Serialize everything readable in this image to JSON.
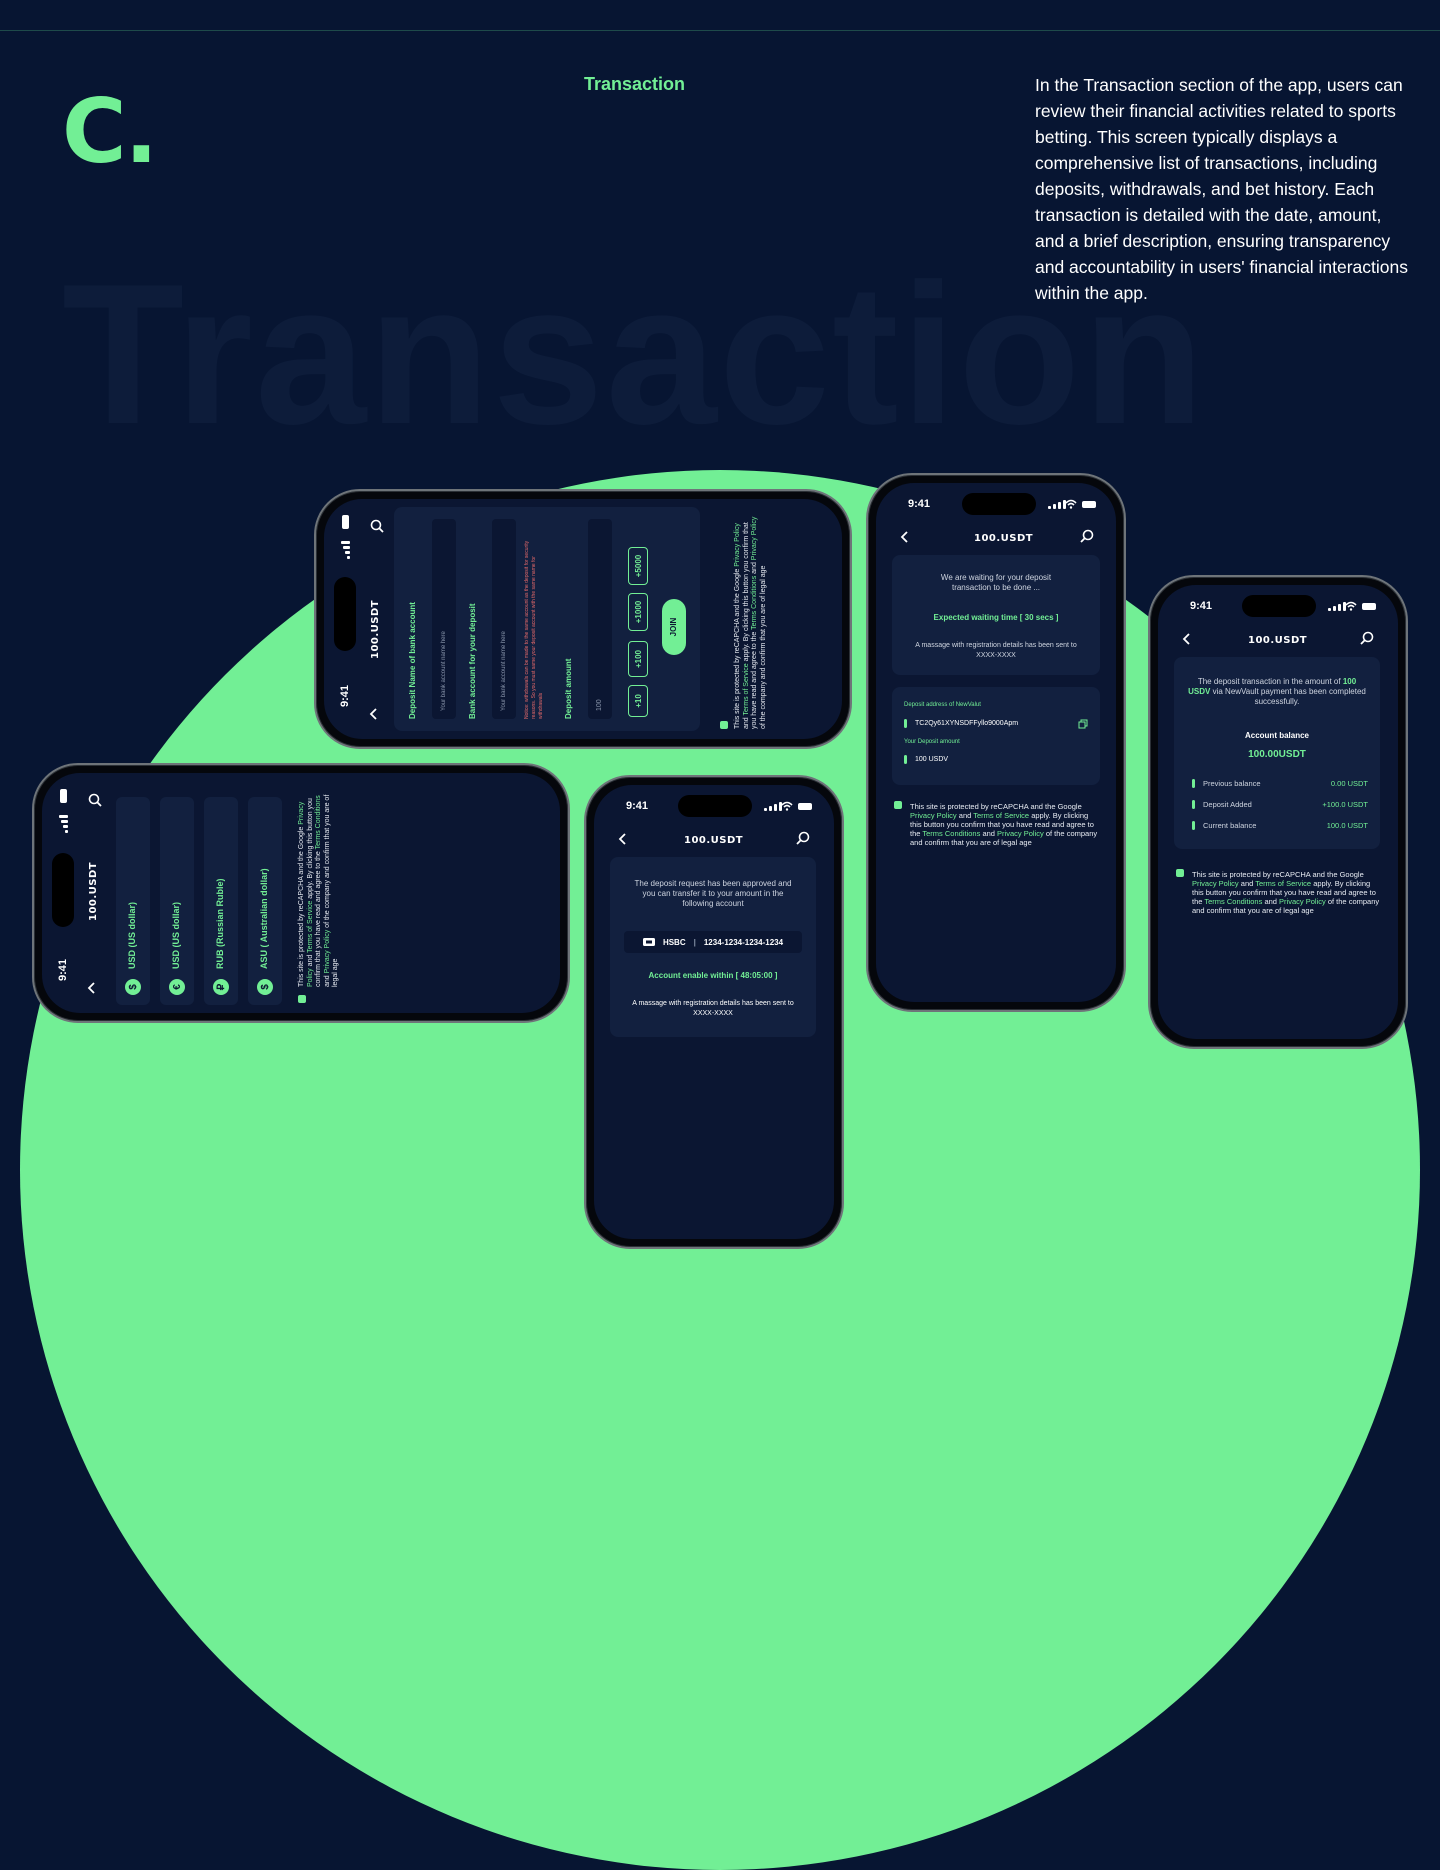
{
  "brand": {
    "logo": "C."
  },
  "section": {
    "title": "Transaction",
    "watermark": "Transaction",
    "description": "In the Transaction section of the app, users can review their financial activities related to sports betting. This screen typically displays a comprehensive list of transactions, including deposits, withdrawals, and bet history. Each transaction is detailed with the date, amount, and a brief description, ensuring transparency and accountability in users' financial interactions within the app."
  },
  "common": {
    "time": "9:41",
    "app_title": "100.USDT",
    "legal": {
      "p1": "This site is protected by reCAPCHA and the Google",
      "privacy": "Privacy Policy",
      "and": "and",
      "terms": "Terms of Service",
      "apply": "apply.",
      "p2": "By clicking this button you confirm that you have read and agree to the",
      "terms_conditions": "Terms Conditions",
      "and2": "and",
      "privacy2": "Privacy",
      "policy": "Policy",
      "p3": "of the company and confirm that you are of legal age"
    }
  },
  "phone_waiting": {
    "waiting_text": "We are waiting for your deposit transaction to be done ...",
    "expected_time": "Expected waiting time [ 30 secs ]",
    "message_text": "A massage with registration details has been sent to XXXX-XXXX",
    "deposit_address_label": "Deposit address of NewValut",
    "deposit_address": "TC2Qy61XYNSDFFyllo9000Apm",
    "amount_label": "Your Deposit amount",
    "amount": "100 USDV"
  },
  "phone_success": {
    "message": "The deposit transaction in the amount of",
    "message_amount": "100 USDV",
    "message_rest": "via NewVault payment has been completed successfully.",
    "balance_label": "Account balance",
    "balance_value": "100.00USDT",
    "rows": [
      {
        "label": "Previous balance",
        "value": "0.00 USDT"
      },
      {
        "label": "Deposit Added",
        "value": "+100.0 USDT"
      },
      {
        "label": "Current balance",
        "value": "100.0 USDT"
      }
    ]
  },
  "phone_approved": {
    "text": "The deposit request has been approved and you can transfer it to your amount in the following account",
    "bank": "HSBC",
    "account": "1234-1234-1234-1234",
    "enable_within": "Account enable within [ 48:05:00 ]",
    "message_text": "A massage with registration details has been sent to XXXX-XXXX"
  },
  "phone_bank_form": {
    "name_label": "Deposit Name of bank account",
    "name_placeholder": "Your bank account name here",
    "account_label": "Bank account for your deposit",
    "account_placeholder": "Your bank account name here",
    "notice": "Notice: withdrawals can be made to the same account as the deposit for security reasons. So you must same your deposit account with the same name for withdrawals",
    "amount_label": "Deposit amount",
    "amount_value": "100",
    "chips": [
      "+10",
      "+100",
      "+1000",
      "+5000"
    ],
    "join": "JOIN"
  },
  "phone_currency": {
    "currencies": [
      {
        "symbol": "$",
        "label": "USD (US dollar)"
      },
      {
        "symbol": "€",
        "label": "USD (US dollar)"
      },
      {
        "symbol": "₽",
        "label": "RUB (Russian Ruble)"
      },
      {
        "symbol": "$",
        "label": "ASU ( Australian dollar)"
      }
    ]
  },
  "colors": {
    "accent": "#72ef95",
    "background": "#071532",
    "card": "#12203f",
    "notice": "#e86a6a"
  },
  "icons": [
    "back-arrow-icon",
    "search-icon",
    "copy-icon",
    "wifi-icon",
    "signal-icon",
    "battery-icon",
    "card-icon",
    "check-icon",
    "chevron-down-icon"
  ]
}
